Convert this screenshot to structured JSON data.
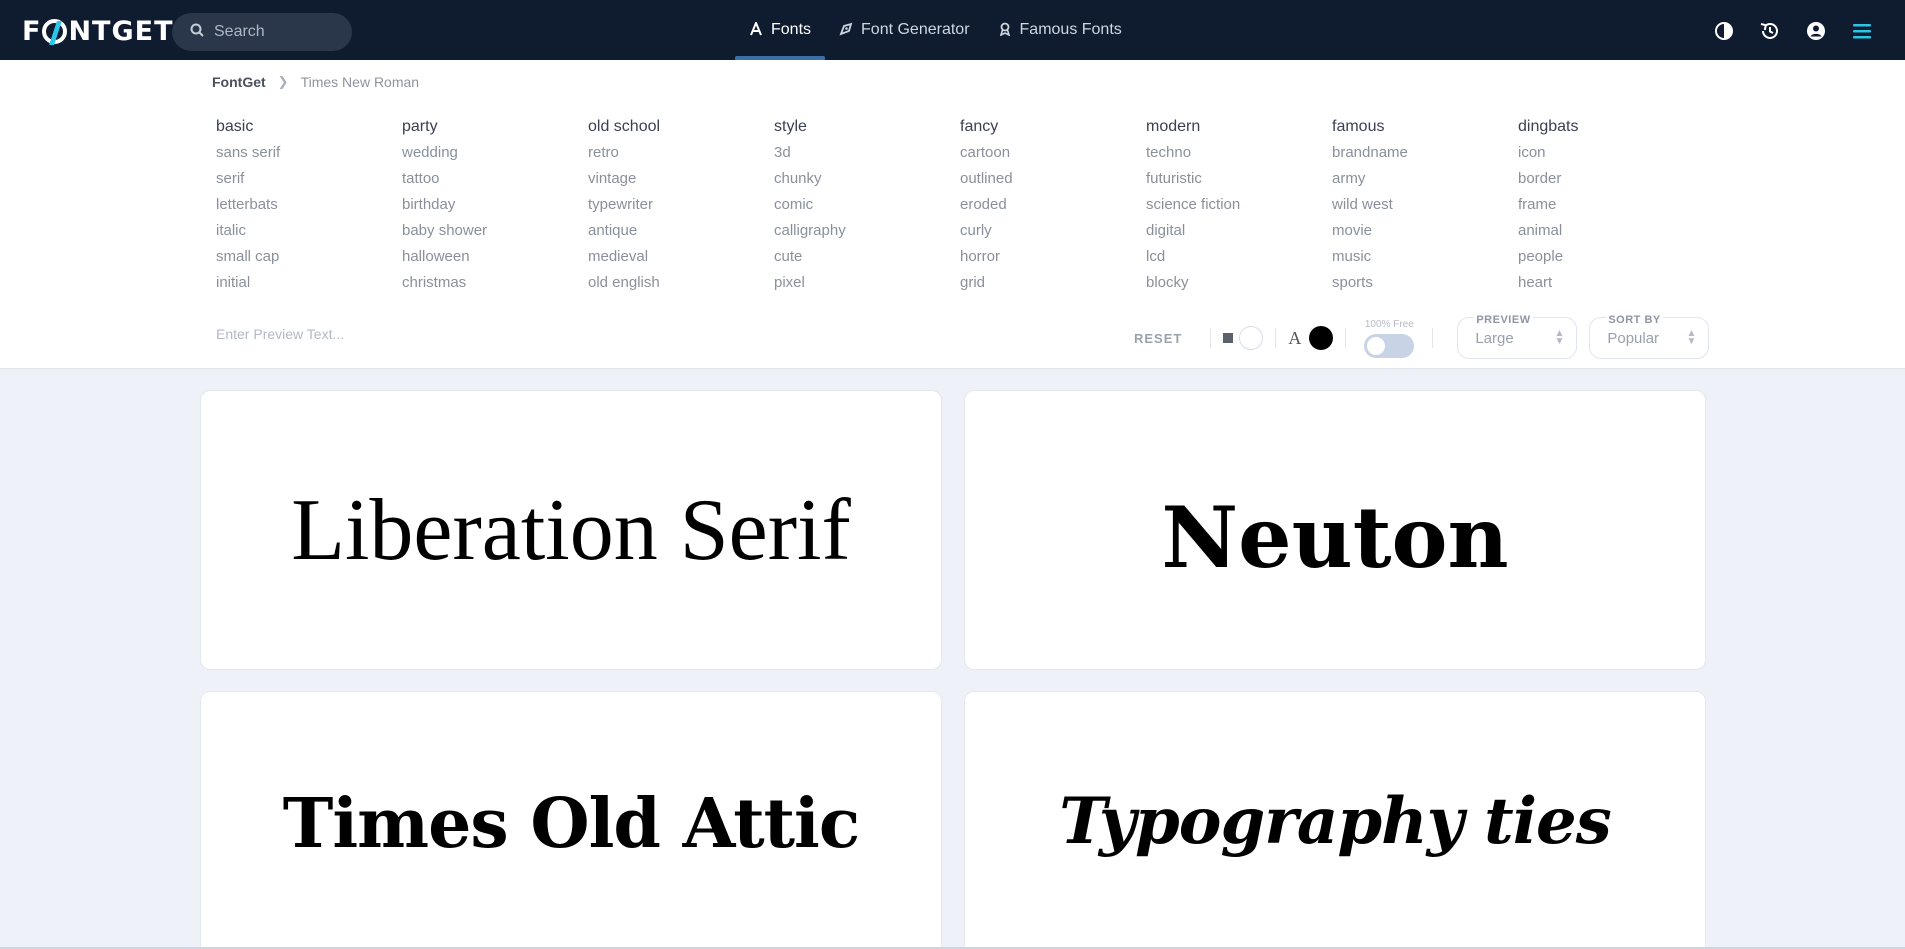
{
  "brand": {
    "logo": "FONTGET"
  },
  "search": {
    "placeholder": "Search"
  },
  "nav": {
    "tabs": [
      {
        "label": "Fonts",
        "icon": "font-a-icon",
        "active": true
      },
      {
        "label": "Font Generator",
        "icon": "pen-nib-icon",
        "active": false
      },
      {
        "label": "Famous Fonts",
        "icon": "award-ribbon-icon",
        "active": false
      }
    ],
    "right_icons": [
      "contrast-icon",
      "history-icon",
      "user-circle-icon",
      "hamburger-menu-icon"
    ]
  },
  "breadcrumb": {
    "home": "FontGet",
    "current": "Times New Roman"
  },
  "categories": [
    {
      "head": "basic",
      "items": [
        "sans serif",
        "serif",
        "letterbats",
        "italic",
        "small cap",
        "initial"
      ]
    },
    {
      "head": "party",
      "items": [
        "wedding",
        "tattoo",
        "birthday",
        "baby shower",
        "halloween",
        "christmas"
      ]
    },
    {
      "head": "old school",
      "items": [
        "retro",
        "vintage",
        "typewriter",
        "antique",
        "medieval",
        "old english"
      ]
    },
    {
      "head": "style",
      "items": [
        "3d",
        "chunky",
        "comic",
        "calligraphy",
        "cute",
        "pixel"
      ]
    },
    {
      "head": "fancy",
      "items": [
        "cartoon",
        "outlined",
        "eroded",
        "curly",
        "horror",
        "grid"
      ]
    },
    {
      "head": "modern",
      "items": [
        "techno",
        "futuristic",
        "science fiction",
        "digital",
        "lcd",
        "blocky"
      ]
    },
    {
      "head": "famous",
      "items": [
        "brandname",
        "army",
        "wild west",
        "movie",
        "music",
        "sports"
      ]
    },
    {
      "head": "dingbats",
      "items": [
        "icon",
        "border",
        "frame",
        "animal",
        "people",
        "heart"
      ]
    }
  ],
  "controls": {
    "preview_placeholder": "Enter Preview Text...",
    "reset_label": "RESET",
    "free_label": "100% Free",
    "preview_label": "PREVIEW",
    "preview_value": "Large",
    "sort_label": "SORT BY",
    "sort_value": "Popular",
    "colors": {
      "background": "#ffffff",
      "foreground": "#000000",
      "nav_bg": "#0f1b2f",
      "accent": "#29c6e8"
    }
  },
  "fonts": [
    {
      "sample": "Liberation Serif"
    },
    {
      "sample": "Neuton"
    },
    {
      "sample": "Times Old Attic"
    },
    {
      "sample": "Typography ties"
    }
  ]
}
